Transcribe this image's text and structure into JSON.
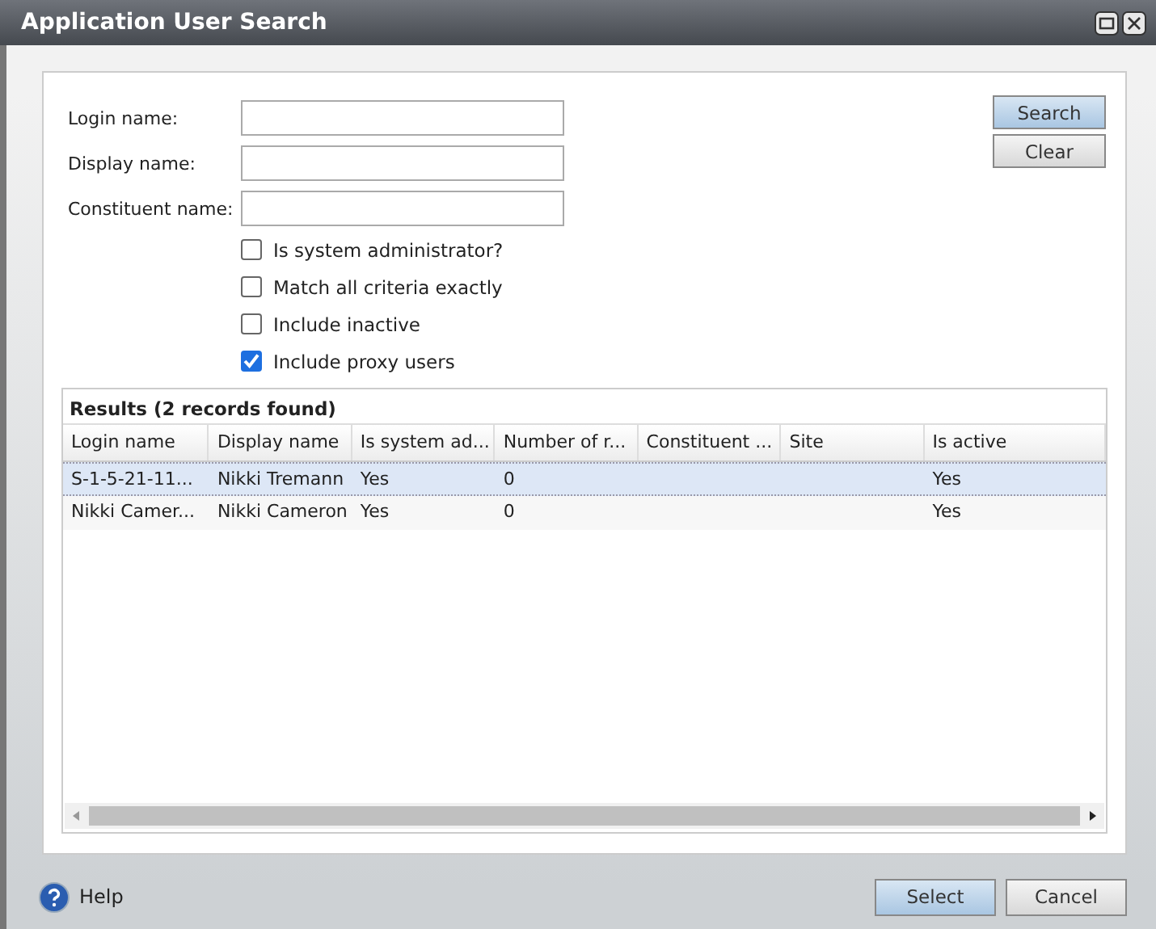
{
  "window": {
    "title": "Application User Search"
  },
  "fields": [
    {
      "label": "Login name:"
    },
    {
      "label": "Display name:"
    },
    {
      "label": "Constituent name:"
    }
  ],
  "checkboxes": [
    {
      "label": "Is system administrator?",
      "checked": false
    },
    {
      "label": "Match all criteria exactly",
      "checked": false
    },
    {
      "label": "Include inactive",
      "checked": false
    },
    {
      "label": "Include proxy users",
      "checked": true
    }
  ],
  "side_buttons": [
    {
      "label": "Search",
      "kind": "primary"
    },
    {
      "label": "Clear",
      "kind": "normal"
    }
  ],
  "results": {
    "title": "Results (2 records found)",
    "columns": [
      "Login name",
      "Display name",
      "Is system ad...",
      "Number of r...",
      "Constituent ...",
      "Site",
      "Is active"
    ],
    "rows": [
      {
        "cells": [
          "S-1-5-21-11...",
          "Nikki Tremann",
          "Yes",
          "0",
          "",
          "",
          "Yes"
        ],
        "selected": true
      },
      {
        "cells": [
          "Nikki Camer...",
          "Nikki Cameron",
          "Yes",
          "0",
          "",
          "",
          "Yes"
        ],
        "selected": false
      }
    ]
  },
  "footer": {
    "help": "Help",
    "buttons": [
      {
        "label": "Select",
        "kind": "primary"
      },
      {
        "label": "Cancel",
        "kind": "normal"
      }
    ]
  }
}
